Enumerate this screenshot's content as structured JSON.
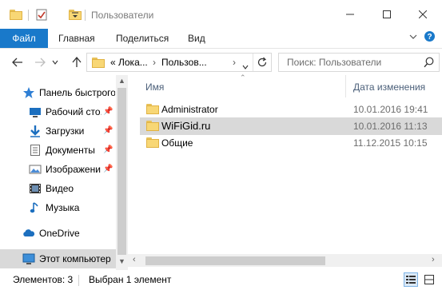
{
  "window": {
    "title": "Пользователи"
  },
  "ribbon": {
    "file_tab": "Файл",
    "tabs": [
      "Главная",
      "Поделиться",
      "Вид"
    ]
  },
  "address": {
    "breadcrumb_prefix": "«",
    "crumbs": [
      "Лока...",
      "Пользов..."
    ],
    "search_placeholder": "Поиск: Пользователи"
  },
  "nav": {
    "items": [
      {
        "label": "Панель быстрого",
        "icon": "star-icon",
        "pinned": false
      },
      {
        "label": "Рабочий сто.",
        "icon": "desktop-icon",
        "pinned": true
      },
      {
        "label": "Загрузки",
        "icon": "download-icon",
        "pinned": true
      },
      {
        "label": "Документы",
        "icon": "documents-icon",
        "pinned": true
      },
      {
        "label": "Изображени",
        "icon": "pictures-icon",
        "pinned": true
      },
      {
        "label": "Видео",
        "icon": "video-icon",
        "pinned": false
      },
      {
        "label": "Музыка",
        "icon": "music-icon",
        "pinned": false
      },
      {
        "label": "OneDrive",
        "icon": "cloud-icon",
        "pinned": false
      },
      {
        "label": "Этот компьютер",
        "icon": "computer-icon",
        "pinned": false
      }
    ]
  },
  "content": {
    "columns": {
      "name": "Имя",
      "date": "Дата изменения"
    },
    "rows": [
      {
        "name": "Administrator",
        "date": "10.01.2016 19:41",
        "selected": false
      },
      {
        "name": "WiFiGid.ru",
        "date": "10.01.2016 11:13",
        "selected": true
      },
      {
        "name": "Общие",
        "date": "11.12.2015 10:15",
        "selected": false
      }
    ]
  },
  "status": {
    "items_count": "Элементов: 3",
    "selected": "Выбран 1 элемент"
  },
  "colors": {
    "accent": "#1979ca",
    "folder": "#f8d775",
    "selection": "#d9d9d9"
  }
}
